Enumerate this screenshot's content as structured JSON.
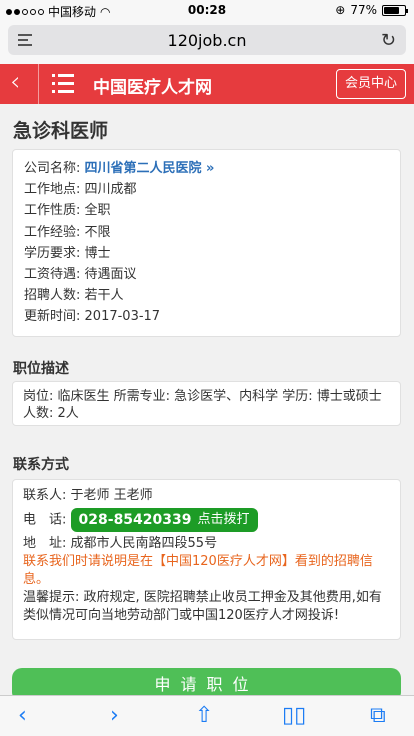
{
  "status": {
    "carrier": "中国移动",
    "time": "00:28",
    "battery": "77%"
  },
  "browser": {
    "url": "120job.cn"
  },
  "header": {
    "site_name": "中国医疗人才网",
    "member_label": "会员中心"
  },
  "job": {
    "title": "急诊科医师",
    "info": [
      {
        "label": "公司名称:",
        "value": "四川省第二人民医院 »"
      },
      {
        "label": "工作地点:",
        "value": "四川成都"
      },
      {
        "label": "工作性质:",
        "value": "全职"
      },
      {
        "label": "工作经验:",
        "value": "不限"
      },
      {
        "label": "学历要求:",
        "value": "博士"
      },
      {
        "label": "工资待遇:",
        "value": "待遇面议"
      },
      {
        "label": "招聘人数:",
        "value": "若干人"
      },
      {
        "label": "更新时间:",
        "value": "2017-03-17"
      }
    ]
  },
  "description": {
    "heading": "职位描述",
    "text": "岗位: 临床医生 所需专业: 急诊医学、内科学 学历: 博士或硕士 人数: 2人"
  },
  "contact": {
    "heading": "联系方式",
    "person_label": "联系人:",
    "person": "于老师 王老师",
    "phone_label": "电　话:",
    "phone": "028-85420339",
    "call_label": "点击拨打",
    "address_label": "地　址:",
    "address": "成都市人民南路四段55号",
    "notice": "联系我们时请说明是在【中国120医疗人才网】看到的招聘信息。",
    "tip": "温馨提示: 政府规定, 医院招聘禁止收员工押金及其他费用,如有类似情况可向当地劳动部门或中国120医疗人才网投诉!"
  },
  "apply_label": "申请职位"
}
